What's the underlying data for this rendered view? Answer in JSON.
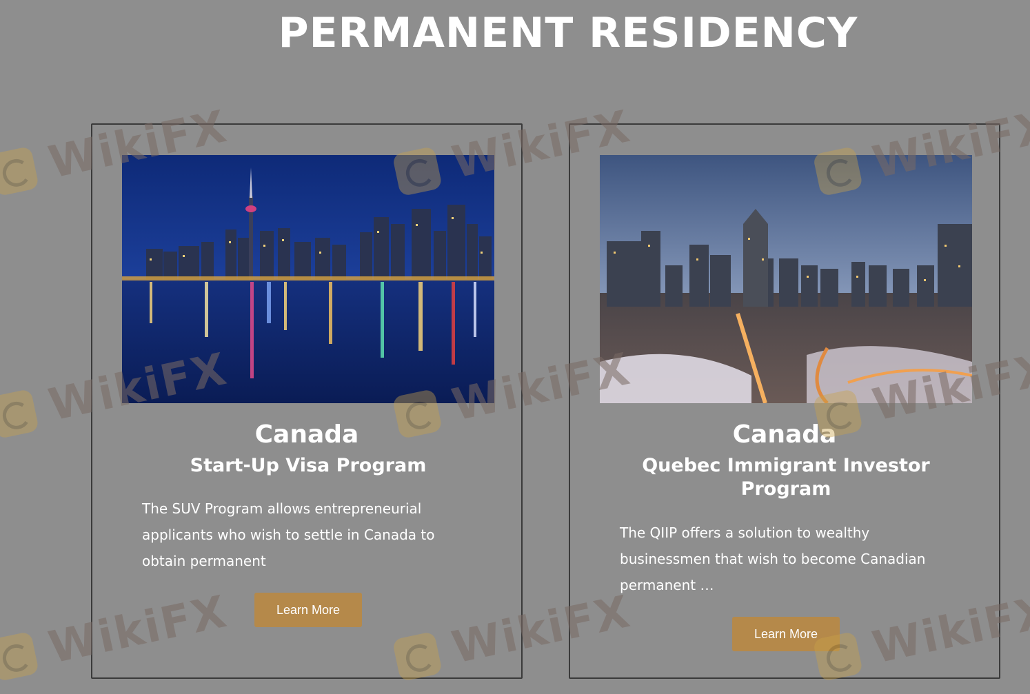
{
  "page": {
    "title": "PERMANENT RESIDENCY"
  },
  "watermark": {
    "text": "WikiFX"
  },
  "cards": [
    {
      "heading": "Canada",
      "subheading": "Start-Up Visa Program",
      "description": "The SUV Program allows entrepreneurial applicants who wish to settle in Canada to obtain permanent",
      "button_label": "Learn More",
      "image_alt": "Toronto skyline at night reflected on the lake"
    },
    {
      "heading": "Canada",
      "subheading": "Quebec Immigrant Investor Program",
      "description": "The QIIP offers a solution to wealthy businessmen that wish to become Canadian permanent …",
      "button_label": "Learn More",
      "image_alt": "Montreal downtown at dusk in winter"
    }
  ],
  "colors": {
    "background": "#8e8e8e",
    "button": "#b5894a",
    "card_border": "#3a3a3a",
    "text": "#ffffff"
  }
}
